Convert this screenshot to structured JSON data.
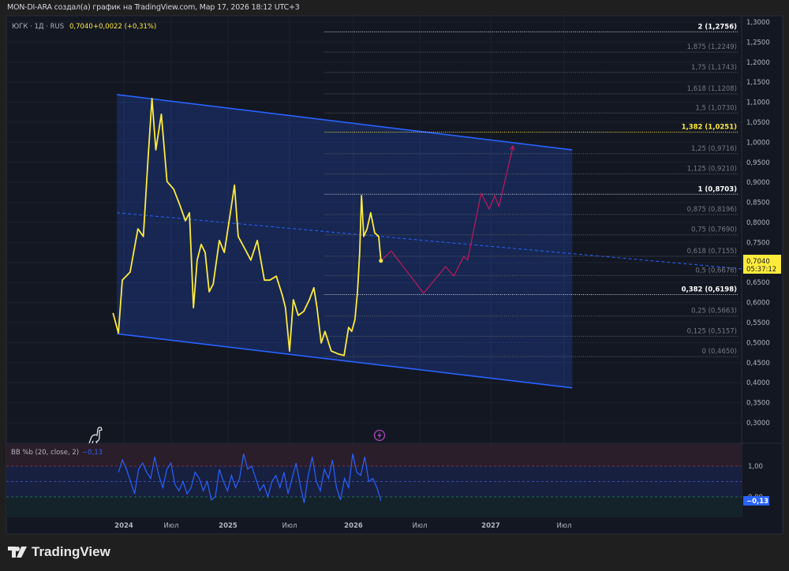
{
  "header": {
    "attribution": "MON-DI-ARA создал(а) график на TradingView.com, Мар 17, 2026 18:12 UTC+3"
  },
  "legend": {
    "symbol": "ЮГК · 1Д · RUS",
    "price": "0,7040",
    "change": "+0,0022 (+0,31%)"
  },
  "price_tag": {
    "price": "0,7040",
    "countdown": "05:37:12"
  },
  "brand": {
    "name": "TradingView"
  },
  "colors": {
    "background": "#131722",
    "price_line": "#ffeb3b",
    "channel": "#2962ff",
    "projection": "#c2185b",
    "bb_line": "#2962ff",
    "fib_gold": "#ffeb3b"
  },
  "chart_data": [
    {
      "type": "line",
      "title": "",
      "y_axis": {
        "range": [
          0.27,
          1.31
        ],
        "ticks": [
          "1,3000",
          "1,2500",
          "1,2000",
          "1,1500",
          "1,1000",
          "1,0500",
          "1,0000",
          "0,9500",
          "0,9000",
          "0,8500",
          "0,8000",
          "0,7500",
          "0,7000",
          "0,6500",
          "0,6000",
          "0,5500",
          "0,5000",
          "0,4500",
          "0,4000",
          "0,3500",
          "0,3000"
        ],
        "tick_values": [
          1.3,
          1.25,
          1.2,
          1.15,
          1.1,
          1.05,
          1.0,
          0.95,
          0.9,
          0.85,
          0.8,
          0.75,
          0.7,
          0.65,
          0.6,
          0.55,
          0.5,
          0.45,
          0.4,
          0.35,
          0.3
        ]
      },
      "x_axis": {
        "ticks": [
          {
            "label": "2024",
            "date": "2024-01-01"
          },
          {
            "label": "Июл",
            "date": "2024-07-01"
          },
          {
            "label": "2025",
            "date": "2025-01-01"
          },
          {
            "label": "Июл",
            "date": "2025-07-01"
          },
          {
            "label": "2026",
            "date": "2026-01-01"
          },
          {
            "label": "Июл",
            "date": "2026-07-01"
          },
          {
            "label": "2027",
            "date": "2027-01-01"
          },
          {
            "label": "Июл",
            "date": "2027-07-01"
          }
        ]
      },
      "grid": true,
      "series": [
        {
          "role": "price",
          "points": [
            [
              "2023-11-20",
              0.574
            ],
            [
              "2023-12-11",
              0.524
            ],
            [
              "2023-12-26",
              0.656
            ],
            [
              "2024-01-25",
              0.676
            ],
            [
              "2024-02-24",
              0.784
            ],
            [
              "2024-03-16",
              0.765
            ],
            [
              "2024-04-03",
              0.961
            ],
            [
              "2024-04-18",
              1.109
            ],
            [
              "2024-05-03",
              0.981
            ],
            [
              "2024-05-24",
              1.07
            ],
            [
              "2024-06-15",
              0.902
            ],
            [
              "2024-07-09",
              0.883
            ],
            [
              "2024-07-29",
              0.843
            ],
            [
              "2024-08-16",
              0.804
            ],
            [
              "2024-08-29",
              0.824
            ],
            [
              "2024-09-11",
              0.587
            ],
            [
              "2024-09-23",
              0.706
            ],
            [
              "2024-10-06",
              0.745
            ],
            [
              "2024-10-19",
              0.725
            ],
            [
              "2024-11-01",
              0.627
            ],
            [
              "2024-11-14",
              0.646
            ],
            [
              "2024-12-04",
              0.755
            ],
            [
              "2024-12-20",
              0.725
            ],
            [
              "2025-01-08",
              0.824
            ],
            [
              "2025-01-20",
              0.893
            ],
            [
              "2025-01-31",
              0.765
            ],
            [
              "2025-02-19",
              0.735
            ],
            [
              "2025-03-09",
              0.706
            ],
            [
              "2025-03-28",
              0.755
            ],
            [
              "2025-04-18",
              0.656
            ],
            [
              "2025-05-04",
              0.656
            ],
            [
              "2025-05-23",
              0.666
            ],
            [
              "2025-06-10",
              0.617
            ],
            [
              "2025-06-19",
              0.587
            ],
            [
              "2025-07-01",
              0.479
            ],
            [
              "2025-07-12",
              0.607
            ],
            [
              "2025-07-26",
              0.568
            ],
            [
              "2025-08-11",
              0.578
            ],
            [
              "2025-08-27",
              0.607
            ],
            [
              "2025-09-09",
              0.637
            ],
            [
              "2025-09-18",
              0.587
            ],
            [
              "2025-09-30",
              0.499
            ],
            [
              "2025-10-11",
              0.528
            ],
            [
              "2025-10-29",
              0.479
            ],
            [
              "2025-11-17",
              0.472
            ],
            [
              "2025-12-05",
              0.468
            ],
            [
              "2025-12-18",
              0.538
            ],
            [
              "2025-12-27",
              0.528
            ],
            [
              "2026-01-05",
              0.558
            ],
            [
              "2026-01-12",
              0.627
            ],
            [
              "2026-01-18",
              0.725
            ],
            [
              "2026-01-23",
              0.867
            ],
            [
              "2026-01-29",
              0.765
            ],
            [
              "2026-02-07",
              0.784
            ],
            [
              "2026-02-17",
              0.824
            ],
            [
              "2026-02-28",
              0.774
            ],
            [
              "2026-03-11",
              0.765
            ],
            [
              "2026-03-17",
              0.704
            ]
          ]
        },
        {
          "role": "projection",
          "points": [
            [
              "2026-03-17",
              0.704
            ],
            [
              "2026-04-14",
              0.729
            ],
            [
              "2026-07-11",
              0.623
            ],
            [
              "2026-09-06",
              0.69
            ],
            [
              "2026-09-27",
              0.666
            ],
            [
              "2026-10-23",
              0.715
            ],
            [
              "2026-11-02",
              0.706
            ],
            [
              "2026-12-07",
              0.873
            ],
            [
              "2026-12-28",
              0.833
            ],
            [
              "2027-01-11",
              0.867
            ],
            [
              "2027-01-21",
              0.839
            ],
            [
              "2027-02-25",
              0.991
            ]
          ]
        }
      ],
      "channel": {
        "upper": [
          [
            "2023-12-05",
            1.119
          ],
          [
            "2027-07-21",
            0.981
          ]
        ],
        "lower": [
          [
            "2023-12-05",
            0.522
          ],
          [
            "2027-07-21",
            0.387
          ]
        ],
        "median": [
          [
            "2023-12-05",
            0.824
          ],
          [
            "2028-09-12",
            0.684
          ]
        ]
      },
      "fibonacci": {
        "start_date": "2025-10-10",
        "levels": [
          {
            "label": "2 (1,2756)",
            "value": 1.2756,
            "style": "major"
          },
          {
            "label": "1,875 (1,2249)",
            "value": 1.2249,
            "style": "minor"
          },
          {
            "label": "1,75 (1,1743)",
            "value": 1.1743,
            "style": "minor"
          },
          {
            "label": "1,618 (1,1208)",
            "value": 1.1208,
            "style": "minor"
          },
          {
            "label": "1,5 (1,0730)",
            "value": 1.073,
            "style": "minor"
          },
          {
            "label": "1,382 (1,0251)",
            "value": 1.0251,
            "style": "gold"
          },
          {
            "label": "1,25 (0,9716)",
            "value": 0.9716,
            "style": "minor"
          },
          {
            "label": "1,125 (0,9210)",
            "value": 0.921,
            "style": "minor"
          },
          {
            "label": "1 (0,8703)",
            "value": 0.8703,
            "style": "major"
          },
          {
            "label": "0,875 (0,8196)",
            "value": 0.8196,
            "style": "minor"
          },
          {
            "label": "0,75 (0,7690)",
            "value": 0.769,
            "style": "minor"
          },
          {
            "label": "0,618 (0,7155)",
            "value": 0.7155,
            "style": "minor"
          },
          {
            "label": "0,5 (0,6676)",
            "value": 0.6676,
            "style": "minor"
          },
          {
            "label": "0,382 (0,6198)",
            "value": 0.6198,
            "style": "major"
          },
          {
            "label": "0,25 (0,5663)",
            "value": 0.5663,
            "style": "minor"
          },
          {
            "label": "0,125 (0,5157)",
            "value": 0.5157,
            "style": "minor"
          },
          {
            "label": "0 (0,4650)",
            "value": 0.465,
            "style": "minor"
          }
        ]
      }
    },
    {
      "type": "line",
      "title": "BB %b (20, close, 2)",
      "current_value": "−0,13",
      "y_axis": {
        "ticks": [
          "1,00",
          "0,00"
        ],
        "tick_values": [
          1.0,
          0.0
        ],
        "bands": {
          "upper": 1.0,
          "middle": 0.5,
          "lower": 0.0
        }
      },
      "x_range": [
        "2023-12-11",
        "2026-03-17"
      ],
      "values": [
        0.8,
        1.2,
        0.9,
        0.5,
        0.1,
        0.9,
        1.1,
        0.8,
        0.6,
        1.3,
        0.7,
        0.3,
        0.9,
        1.1,
        0.4,
        0.2,
        0.5,
        0.1,
        0.3,
        0.8,
        0.6,
        0.2,
        0.5,
        -0.1,
        0.0,
        0.9,
        0.5,
        0.2,
        0.7,
        0.3,
        0.6,
        1.4,
        0.9,
        1.0,
        0.6,
        0.2,
        0.4,
        0.0,
        0.5,
        0.7,
        0.3,
        0.8,
        0.1,
        0.6,
        1.1,
        0.4,
        -0.2,
        0.7,
        1.3,
        0.5,
        0.2,
        0.9,
        0.6,
        1.2,
        0.3,
        -0.1,
        0.6,
        0.3,
        1.4,
        0.8,
        0.7,
        1.3,
        0.5,
        0.6,
        0.3,
        -0.13
      ]
    }
  ]
}
